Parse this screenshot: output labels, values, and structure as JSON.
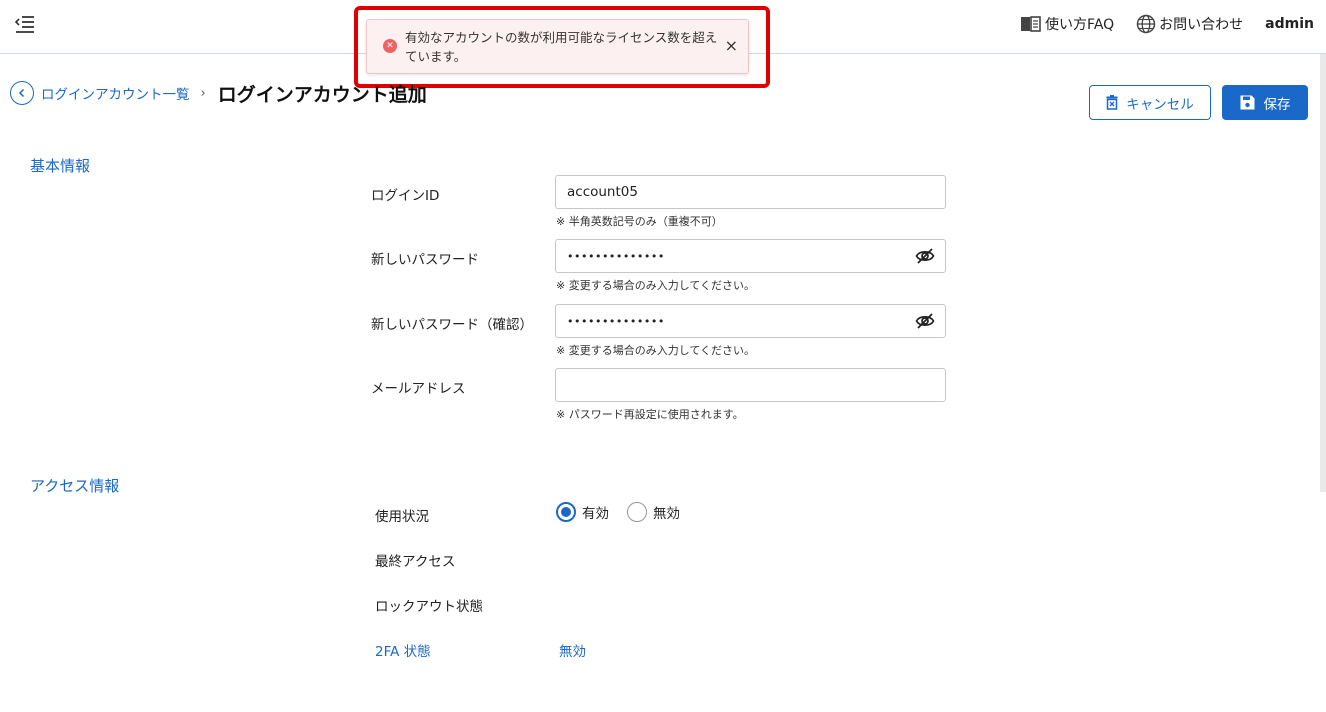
{
  "topbar": {
    "faq_label": "使い方FAQ",
    "contact_label": "お問い合わせ",
    "user_label": "admin"
  },
  "toast": {
    "message": "有効なアカウントの数が利用可能なライセンス数を超えています。",
    "close": "×",
    "icon": "error-icon"
  },
  "breadcrumb": {
    "parent": "ログインアカウント一覧",
    "separator": "›",
    "current": "ログインアカウント追加"
  },
  "actions": {
    "cancel_label": "キャンセル",
    "save_label": "保存"
  },
  "basic_info": {
    "section_title": "基本情報",
    "login_id": {
      "label": "ログインID",
      "value": "account05",
      "hint": "※ 半角英数記号のみ（重複不可）"
    },
    "new_password": {
      "label": "新しいパスワード",
      "value": "••••••••••••••",
      "hint": "※ 変更する場合のみ入力してください。"
    },
    "confirm_password": {
      "label": "新しいパスワード（確認）",
      "value": "••••••••••••••",
      "hint": "※ 変更する場合のみ入力してください。"
    },
    "email": {
      "label": "メールアドレス",
      "value": "",
      "hint": "※ パスワード再設定に使用されます。"
    }
  },
  "access_info": {
    "section_title": "アクセス情報",
    "status": {
      "label": "使用状況",
      "options": [
        "有効",
        "無効"
      ],
      "selected": "有効"
    },
    "last_access": {
      "label": "最終アクセス",
      "value": ""
    },
    "lockout": {
      "label": "ロックアウト状態",
      "value": ""
    },
    "twofa": {
      "label": "2FA 状態",
      "value": "無効"
    }
  },
  "colors": {
    "accent": "#1a68c8",
    "error_border": "#e00000",
    "toast_bg": "#fdf0f0"
  }
}
